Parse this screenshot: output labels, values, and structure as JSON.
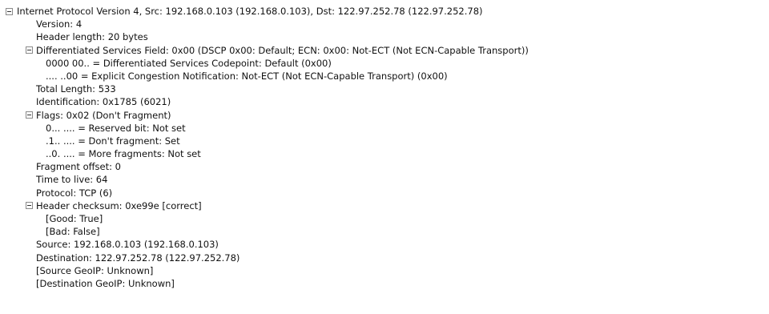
{
  "tree": {
    "rows": [
      {
        "level": 0,
        "expanded": true,
        "text": "Internet Protocol Version 4, Src: 192.168.0.103 (192.168.0.103), Dst: 122.97.252.78 (122.97.252.78)"
      },
      {
        "level": 1,
        "expanded": null,
        "text": "Version: 4"
      },
      {
        "level": 1,
        "expanded": null,
        "text": "Header length: 20 bytes"
      },
      {
        "level": 1,
        "expanded": true,
        "text": "Differentiated Services Field: 0x00 (DSCP 0x00: Default; ECN: 0x00: Not-ECT (Not ECN-Capable Transport))"
      },
      {
        "level": 2,
        "expanded": null,
        "text": "0000 00.. = Differentiated Services Codepoint: Default (0x00)"
      },
      {
        "level": 2,
        "expanded": null,
        "text": ".... ..00 = Explicit Congestion Notification: Not-ECT (Not ECN-Capable Transport) (0x00)"
      },
      {
        "level": 1,
        "expanded": null,
        "text": "Total Length: 533"
      },
      {
        "level": 1,
        "expanded": null,
        "text": "Identification: 0x1785 (6021)"
      },
      {
        "level": 1,
        "expanded": true,
        "text": "Flags: 0x02 (Don't Fragment)"
      },
      {
        "level": 2,
        "expanded": null,
        "text": "0... .... = Reserved bit: Not set"
      },
      {
        "level": 2,
        "expanded": null,
        "text": ".1.. .... = Don't fragment: Set"
      },
      {
        "level": 2,
        "expanded": null,
        "text": "..0. .... = More fragments: Not set"
      },
      {
        "level": 1,
        "expanded": null,
        "text": "Fragment offset: 0"
      },
      {
        "level": 1,
        "expanded": null,
        "text": "Time to live: 64"
      },
      {
        "level": 1,
        "expanded": null,
        "text": "Protocol: TCP (6)"
      },
      {
        "level": 1,
        "expanded": true,
        "text": "Header checksum: 0xe99e [correct]"
      },
      {
        "level": 2,
        "expanded": null,
        "text": "[Good: True]"
      },
      {
        "level": 2,
        "expanded": null,
        "text": "[Bad: False]"
      },
      {
        "level": 1,
        "expanded": null,
        "text": "Source: 192.168.0.103 (192.168.0.103)"
      },
      {
        "level": 1,
        "expanded": null,
        "text": "Destination: 122.97.252.78 (122.97.252.78)"
      },
      {
        "level": 1,
        "expanded": null,
        "text": "[Source GeoIP: Unknown]"
      },
      {
        "level": 1,
        "expanded": null,
        "text": "[Destination GeoIP: Unknown]"
      }
    ]
  }
}
